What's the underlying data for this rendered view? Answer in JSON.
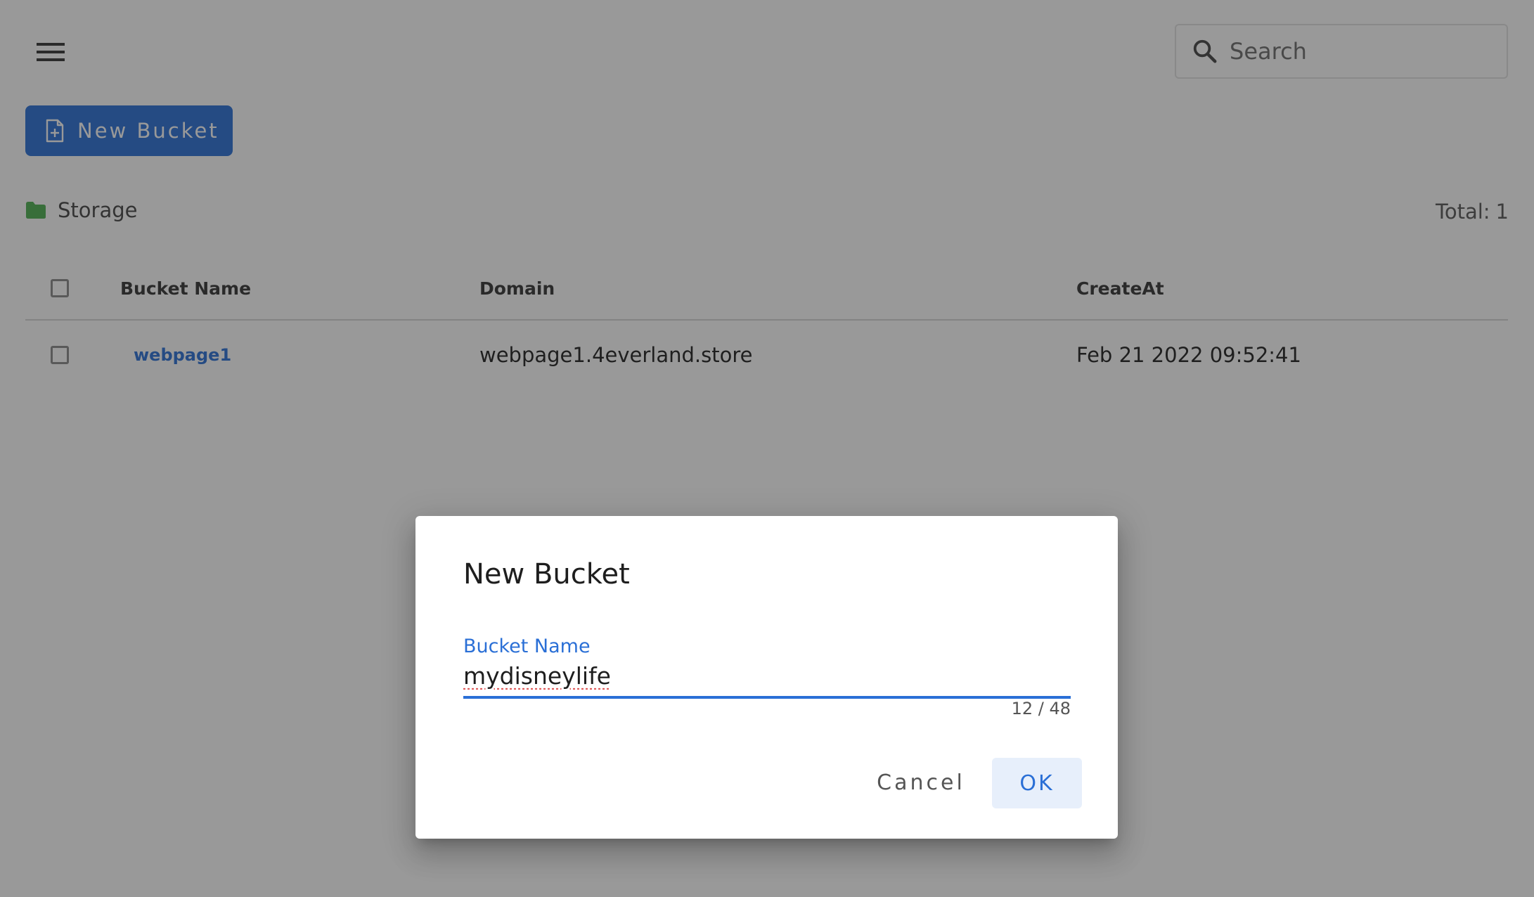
{
  "header": {
    "menu_icon": "hamburger-menu-icon",
    "search": {
      "icon": "search-icon",
      "placeholder": "Search",
      "value": ""
    }
  },
  "toolbar": {
    "new_bucket_icon": "file-plus-icon",
    "new_bucket_label": "New Bucket"
  },
  "breadcrumb": {
    "icon": "folder-icon",
    "label": "Storage"
  },
  "total": {
    "label": "Total:",
    "value": "1"
  },
  "table": {
    "columns": [
      "Bucket Name",
      "Domain",
      "CreateAt"
    ],
    "rows": [
      {
        "name": "webpage1",
        "domain": "webpage1.4everland.store",
        "created": "Feb 21 2022 09:52:41"
      }
    ]
  },
  "dialog": {
    "title": "New Bucket",
    "field_label": "Bucket Name",
    "field_value": "mydisneylife",
    "counter": "12 / 48",
    "cancel_label": "Cancel",
    "ok_label": "OK"
  },
  "colors": {
    "accent": "#2a6fd6",
    "folder": "#4caf50",
    "overlay": "rgba(33,33,33,0.46)"
  }
}
